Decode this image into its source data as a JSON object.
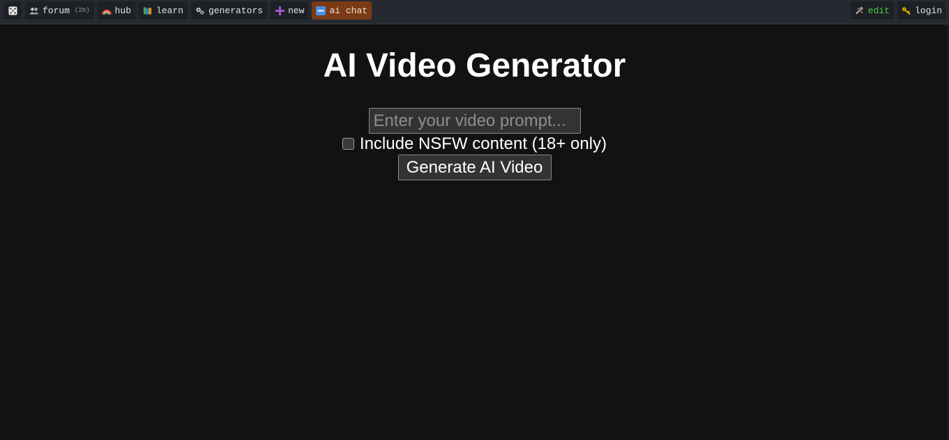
{
  "nav": {
    "left": [
      {
        "key": "random",
        "icon": "dice-icon",
        "label": ""
      },
      {
        "key": "forum",
        "icon": "people-icon",
        "label": "forum",
        "badge": "(2h)"
      },
      {
        "key": "hub",
        "icon": "rainbow-icon",
        "label": "hub"
      },
      {
        "key": "learn",
        "icon": "books-icon",
        "label": "learn"
      },
      {
        "key": "generators",
        "icon": "gears-icon",
        "label": "generators"
      },
      {
        "key": "new",
        "icon": "plus-icon",
        "label": "new"
      },
      {
        "key": "ai-chat",
        "icon": "new-badge-icon",
        "label": "ai chat"
      }
    ],
    "right": [
      {
        "key": "edit",
        "icon": "tools-icon",
        "label": "edit"
      },
      {
        "key": "login",
        "icon": "key-icon",
        "label": "login"
      }
    ]
  },
  "page": {
    "title": "AI Video Generator",
    "prompt_placeholder": "Enter your video prompt...",
    "prompt_value": "",
    "nsfw_label": "Include NSFW content (18+ only)",
    "nsfw_checked": false,
    "generate_label": "Generate AI Video"
  },
  "colors": {
    "background": "#121212",
    "topbar": "#262a30",
    "accent_button": "#7b3a14",
    "edit_text": "#3fd14a"
  }
}
